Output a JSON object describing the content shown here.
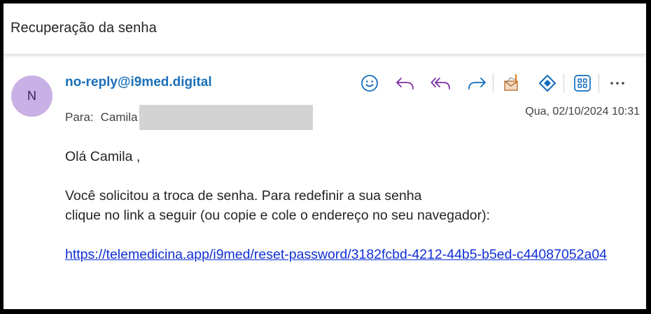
{
  "email": {
    "subject": "Recuperação da senha",
    "sender_initial": "N",
    "sender": "no-reply@i9med.digital",
    "to_label": "Para:",
    "to_name": "Camila",
    "date": "Qua, 02/10/2024 10:31"
  },
  "toolbar": {
    "icons": [
      "emoji-icon",
      "reply-icon",
      "reply-all-icon",
      "forward-icon",
      "mail-report-icon",
      "tag-icon",
      "apps-icon",
      "more-icon"
    ],
    "more_label": "···"
  },
  "body": {
    "greeting": "Olá Camila ,",
    "line1": "Você solicitou a troca de senha. Para redefinir a sua senha",
    "line2": "clique no link a seguir (ou copie e cole o endereço no seu navegador):",
    "link": "https://telemedicina.app/i9med/reset-password/3182fcbd-4212-44b5-b5ed-c44087052a04"
  },
  "colors": {
    "accent": "#1a6fba",
    "toolbar_icon": "#0f6cbd",
    "reply_icon": "#7b2fa3",
    "avatar_bg": "#c8b1e4",
    "link": "#0f2fd6"
  }
}
